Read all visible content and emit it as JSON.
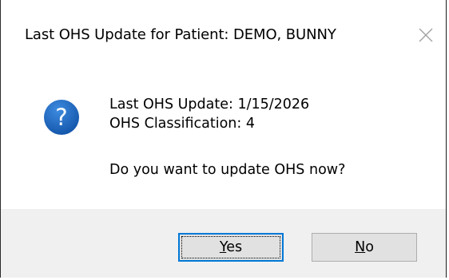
{
  "dialog": {
    "title": "Last OHS Update for Patient: DEMO, BUNNY",
    "close_icon": "close-icon",
    "icon": "question-icon",
    "colors": {
      "icon_blue": "#1565c0",
      "footer_bg": "#f0f0f0",
      "default_button_border": "#0078d7"
    }
  },
  "message": {
    "line1": "Last OHS Update: 1/15/2026",
    "line2": "OHS Classification: 4",
    "line3": "Do you want to update OHS now?"
  },
  "buttons": {
    "yes": {
      "mnemonic": "Y",
      "rest": "es"
    },
    "no": {
      "mnemonic": "N",
      "rest": "o"
    }
  }
}
